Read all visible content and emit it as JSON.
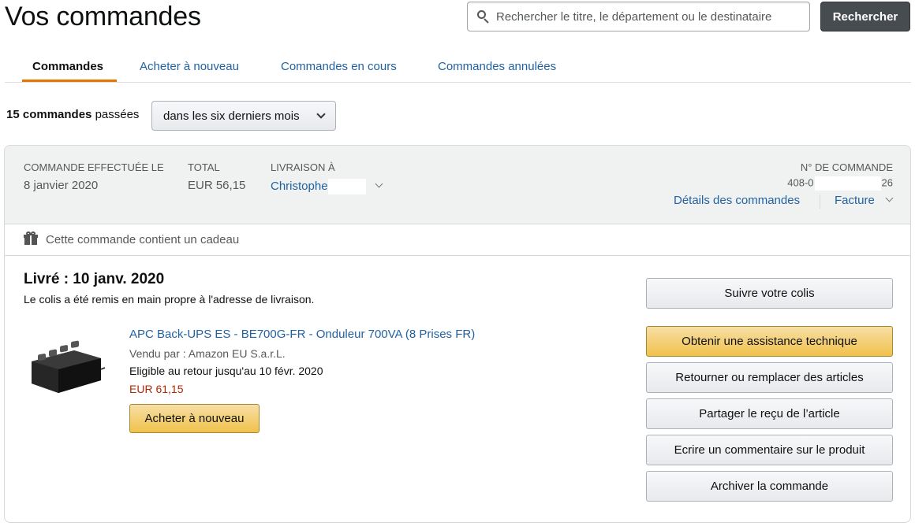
{
  "page": {
    "title": "Vos commandes"
  },
  "search": {
    "placeholder": "Rechercher le titre, le département ou le destinataire",
    "button_label": "Rechercher"
  },
  "tabs": [
    {
      "label": "Commandes",
      "active": true
    },
    {
      "label": "Acheter à nouveau",
      "active": false
    },
    {
      "label": "Commandes en cours",
      "active": false
    },
    {
      "label": "Commandes annulées",
      "active": false
    }
  ],
  "orders_summary": {
    "count_label": "15 commandes",
    "suffix": "passées",
    "period_selected": "dans les six derniers mois"
  },
  "order": {
    "placed_label": "COMMANDE EFFECTUÉE LE",
    "placed_value": "8 janvier 2020",
    "total_label": "TOTAL",
    "total_value": "EUR 56,15",
    "ship_to_label": "LIVRAISON À",
    "ship_to_value": "Christophe",
    "order_number_label": "N° DE COMMANDE",
    "order_number_prefix": "408-0",
    "order_number_suffix": "26",
    "details_link": "Détails des commandes",
    "invoice_link": "Facture",
    "gift_text": "Cette commande contient un cadeau",
    "delivery_status": "Livré : 10 janv. 2020",
    "delivery_detail": "Le colis a été remis en main propre à l'adresse de livraison.",
    "item": {
      "title": "APC Back-UPS ES - BE700G-FR - Onduleur 700VA (8 Prises FR)",
      "seller": "Vendu par : Amazon EU S.a.r.L.",
      "return_eligibility": "Eligible au retour jusqu'au 10 févr. 2020",
      "price": "EUR 61,15",
      "buy_again_label": "Acheter à nouveau"
    },
    "actions": [
      "Suivre votre colis",
      "Obtenir une assistance technique",
      "Retourner ou remplacer des articles",
      "Partager le reçu de l’article",
      "Ecrire un commentaire sur le produit",
      "Archiver la commande"
    ]
  },
  "colors": {
    "link": "#2162a1",
    "accent_underline": "#e77600",
    "primary_button": "#f0c14b",
    "price": "#b12704",
    "search_button": "#474c51"
  }
}
